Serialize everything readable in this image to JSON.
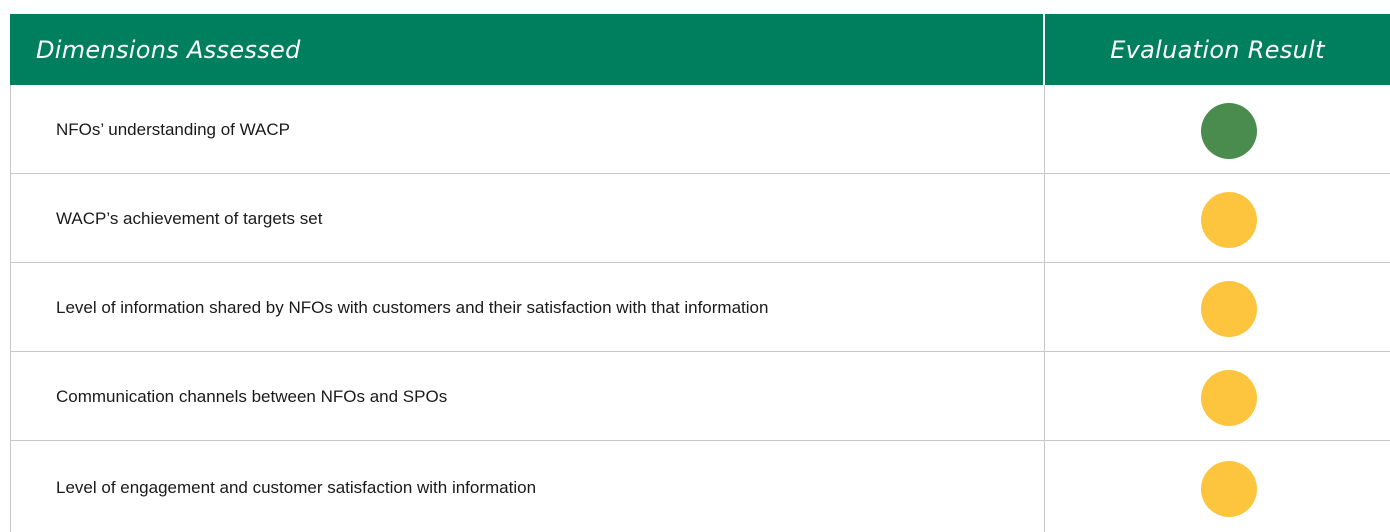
{
  "header": {
    "dimensions_label": "Dimensions Assessed",
    "result_label": "Evaluation Result"
  },
  "colors": {
    "header_bg": "#007f5f",
    "green": "#4a8b4e",
    "amber": "#fdc43e"
  },
  "rows": [
    {
      "dimension": "NFOs’ understanding of WACP",
      "result": "green"
    },
    {
      "dimension": "WACP’s achievement of targets set",
      "result": "amber"
    },
    {
      "dimension": "Level of information shared by NFOs with customers and their satisfaction with that information",
      "result": "amber"
    },
    {
      "dimension": "Communication channels between NFOs and SPOs",
      "result": "amber"
    },
    {
      "dimension": "Level of engagement and customer satisfaction with information",
      "result": "amber"
    }
  ]
}
